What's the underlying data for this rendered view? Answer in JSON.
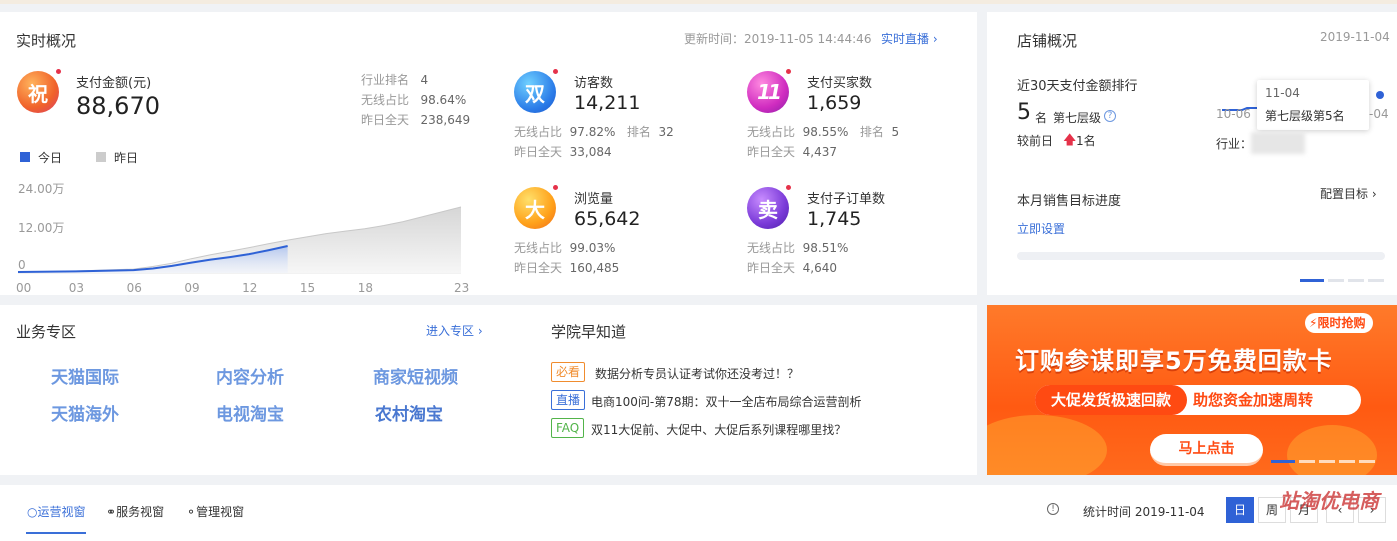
{
  "realtime": {
    "title": "实时概况",
    "updated": "更新时间：2019-11-05 14:44:46",
    "live_link": "实时直播",
    "payment": {
      "badge": "祝",
      "label": "支付金额(元)",
      "value": "88,670",
      "rank_label": "行业排名",
      "rank_value": "4",
      "wireless_label": "无线占比",
      "wireless_value": "98.64%",
      "yesterday_label": "昨日全天",
      "yesterday_value": "238,649"
    },
    "legend": {
      "today": "今日",
      "yesterday": "昨日"
    },
    "metrics": [
      {
        "badge": "双",
        "label": "访客数",
        "value": "14,211",
        "wireless_label": "无线占比",
        "wireless": "97.82%",
        "rank_label": "排名",
        "rank": "32",
        "yesterday_label": "昨日全天",
        "yesterday": "33,084"
      },
      {
        "badge": "11",
        "label": "支付买家数",
        "value": "1,659",
        "wireless_label": "无线占比",
        "wireless": "98.55%",
        "rank_label": "排名",
        "rank": "5",
        "yesterday_label": "昨日全天",
        "yesterday": "4,437"
      },
      {
        "badge": "大",
        "label": "浏览量",
        "value": "65,642",
        "wireless_label": "无线占比",
        "wireless": "99.03%",
        "yesterday_label": "昨日全天",
        "yesterday": "160,485"
      },
      {
        "badge": "卖",
        "label": "支付子订单数",
        "value": "1,745",
        "wireless_label": "无线占比",
        "wireless": "98.51%",
        "yesterday_label": "昨日全天",
        "yesterday": "4,640"
      }
    ],
    "colors": {
      "today": "#2f62d6",
      "yesterday": "#cccccc",
      "accent": "#3a6fd8"
    }
  },
  "chart_data": {
    "type": "area",
    "x_ticks": [
      "00",
      "03",
      "06",
      "09",
      "12",
      "15",
      "18",
      "23"
    ],
    "y_ticks": [
      "24.00万",
      "12.00万",
      "0"
    ],
    "ylim": [
      0,
      24
    ],
    "series": [
      {
        "name": "今日",
        "x": [
          0,
          3,
          6,
          7,
          8,
          9,
          10,
          11,
          12,
          13,
          14
        ],
        "y": [
          0.3,
          0.5,
          0.9,
          1.4,
          2.2,
          3.2,
          4.1,
          4.9,
          5.8,
          7.0,
          8.3
        ]
      },
      {
        "name": "昨日",
        "x": [
          0,
          3,
          6,
          7,
          8,
          9,
          10,
          11,
          12,
          13,
          14,
          15,
          16,
          17,
          18,
          19,
          20,
          21,
          22,
          23
        ],
        "y": [
          0.3,
          0.6,
          1.2,
          2.0,
          3.0,
          4.4,
          5.6,
          6.7,
          7.8,
          9.0,
          10.1,
          11.1,
          12.1,
          12.9,
          13.6,
          14.6,
          15.8,
          17.3,
          18.8,
          20.3
        ]
      }
    ]
  },
  "shop": {
    "title": "店铺概况",
    "date": "2019-11-04",
    "ranking_title": "近30天支付金额排行",
    "rank_number": "5",
    "rank_unit": "名",
    "level": "第七层级",
    "compare_label": "较前日",
    "compare_value": "1名",
    "industry_label": "行业：",
    "axis_start": "10-06",
    "axis_end": "-04",
    "tooltip_date": "11-04",
    "tooltip_text": "第七层级第5名",
    "target_title": "本月销售目标进度",
    "target_config": "配置目标",
    "target_set": "立即设置"
  },
  "business": {
    "title": "业务专区",
    "enter_link": "进入专区",
    "links": [
      "天猫国际",
      "内容分析",
      "商家短视频",
      "天猫海外",
      "电视淘宝",
      "农村淘宝"
    ]
  },
  "academy": {
    "title": "学院早知道",
    "news": [
      {
        "tag": "必看",
        "text": "数据分析专员认证考试你还没考过！？",
        "color": "#f08c2e"
      },
      {
        "tag": "直播",
        "text": "电商100问-第78期：双十一全店布局综合运营剖析",
        "color": "#3a6fd8"
      },
      {
        "tag": "FAQ",
        "text": "双11大促前、大促中、大促后系列课程哪里找？",
        "color": "#52b44a"
      }
    ]
  },
  "banner": {
    "tag": "限时抢购",
    "headline": "订购参谋即享5万免费回款卡",
    "sub_left": "大促发货极速回款",
    "sub_right": "助您资金加速周转",
    "cta": "马上点击"
  },
  "tabs": {
    "items": [
      "运营视窗",
      "服务视窗",
      "管理视窗"
    ],
    "stat_time": "统计时间 2019-11-04",
    "periods": [
      "日",
      "周",
      "月"
    ],
    "watermark": "站淘优电商"
  }
}
